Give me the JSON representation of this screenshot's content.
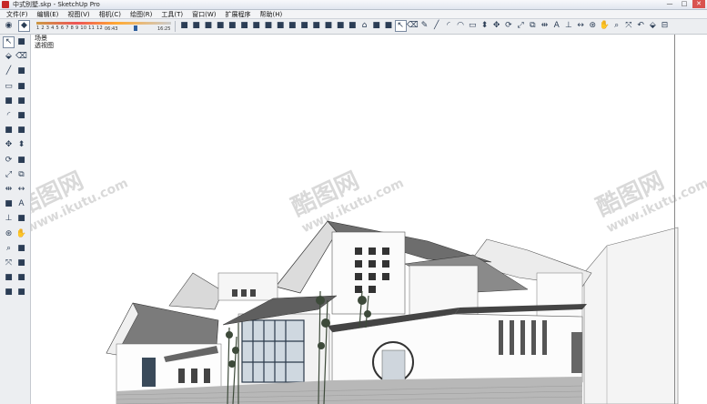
{
  "window": {
    "title": "中式别墅.skp - SketchUp Pro",
    "minimize": "—",
    "maximize": "□",
    "close": "✕"
  },
  "menu": [
    "文件(F)",
    "编辑(E)",
    "视图(V)",
    "相机(C)",
    "绘图(R)",
    "工具(T)",
    "窗口(W)",
    "扩展程序",
    "帮助(H)"
  ],
  "shadow": {
    "months": "1 2 3 4 5 6 7 8 9 10 11 12",
    "time_start": "06:43",
    "time_end": "16:25"
  },
  "scene_tabs": [
    "场景",
    "透视图"
  ],
  "watermarks": [
    {
      "brand": "酷图网",
      "url": "www.ikutu.com"
    },
    {
      "brand": "酷图网",
      "url": "www.ikutu.com"
    },
    {
      "brand": "酷图网",
      "url": "www.ikutu.com"
    }
  ],
  "toolbar_icons": [
    "camera-icon",
    "box-icon",
    "shadow-icon",
    "fog-icon",
    "iso-view-icon",
    "top-view-icon",
    "front-view-icon",
    "right-view-icon",
    "back-view-icon",
    "left-view-icon",
    "xray-icon",
    "wireframe-icon",
    "hidden-line-icon",
    "shaded-icon",
    "textured-icon",
    "monochrome-icon",
    "component-icon",
    "house-icon",
    "warehouse-icon",
    "share-icon",
    "select-icon",
    "eraser-icon",
    "pencil-icon",
    "line-icon",
    "arc-icon",
    "arc2-icon",
    "rectangle-icon",
    "pushpull-icon",
    "move-icon",
    "rotate-icon",
    "scale-icon",
    "offset-icon",
    "tape-icon",
    "text-icon",
    "axes-icon",
    "dimension-icon",
    "orbit-icon",
    "pan-icon",
    "zoom-icon",
    "zoom-extents-icon",
    "previous-icon",
    "paint-icon",
    "section-icon"
  ],
  "left_icons": [
    "select-icon",
    "component-icon",
    "paint-icon",
    "eraser-icon",
    "line-icon",
    "freehand-icon",
    "rectangle-icon",
    "rotated-rect-icon",
    "circle-icon",
    "polygon-icon",
    "arc-icon",
    "arc-3pt-icon",
    "pie-icon",
    "arc-2pt-icon",
    "move-icon",
    "pushpull-icon",
    "rotate-icon",
    "followme-icon",
    "scale-icon",
    "offset-icon",
    "tape-icon",
    "dimension-icon",
    "protractor-icon",
    "text-icon",
    "axes-icon",
    "3dtext-icon",
    "orbit-icon",
    "pan-icon",
    "zoom-icon",
    "zoom-window-icon",
    "zoom-extents-icon",
    "position-camera-icon",
    "walk-icon",
    "lookaround-icon",
    "section-plane-icon",
    "footprints-icon"
  ]
}
